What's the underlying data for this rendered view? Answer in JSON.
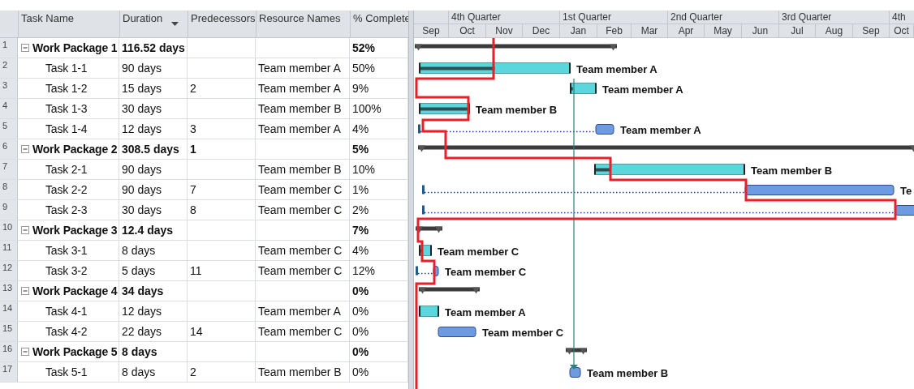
{
  "table": {
    "columns": [
      {
        "label": "Task Name"
      },
      {
        "label": "Duration",
        "filter_arrow": true
      },
      {
        "label": "Predecessors"
      },
      {
        "label": "Resource Names"
      },
      {
        "label": "% Complete"
      }
    ],
    "packages": [
      {
        "number": "1",
        "name": "Work Package 1",
        "duration": "116.52 days",
        "complete": "52%",
        "expanded": true,
        "bar": {
          "kind": "summary"
        },
        "children": [
          {
            "number": "2",
            "name": "Task 1-1",
            "duration": "90 days",
            "resource": "Team member A",
            "complete": "50%",
            "bar": {
              "kind": "active",
              "level": 0.5,
              "label": "Team member A"
            }
          },
          {
            "number": "3",
            "name": "Task 1-2",
            "duration": "15 days",
            "predecessors": "2",
            "resource": "Team member A",
            "complete": "9%",
            "bar": {
              "kind": "active",
              "level": 0.09,
              "label": "Team member A"
            }
          },
          {
            "number": "4",
            "name": "Task 1-3",
            "duration": "30 days",
            "resource": "Team member B",
            "complete": "100%",
            "bar": {
              "kind": "active",
              "level": 1,
              "label": "Team member B"
            }
          },
          {
            "number": "5",
            "name": "Task 1-4",
            "duration": "12 days",
            "predecessors": "3",
            "resource": "Team member A",
            "complete": "4%",
            "bar": {
              "kind": "split",
              "label": "Team member A"
            }
          }
        ]
      },
      {
        "number": "6",
        "name": "Work Package 2",
        "duration": "308.5 days",
        "predecessors": "1",
        "complete": "5%",
        "expanded": true,
        "bar": {
          "kind": "summary"
        },
        "children": [
          {
            "number": "7",
            "name": "Task 2-1",
            "duration": "90 days",
            "resource": "Team member B",
            "complete": "10%",
            "bar": {
              "kind": "active",
              "level": 0.1,
              "label": "Team member B"
            }
          },
          {
            "number": "8",
            "name": "Task 2-2",
            "duration": "90 days",
            "predecessors": "7",
            "resource": "Team member C",
            "complete": "1%",
            "bar": {
              "kind": "split",
              "label": "Te"
            }
          },
          {
            "number": "9",
            "name": "Task 2-3",
            "duration": "30 days",
            "predecessors": "8",
            "resource": "Team member C",
            "complete": "2%",
            "bar": {
              "kind": "split"
            }
          }
        ]
      },
      {
        "number": "10",
        "name": "Work Package 3",
        "duration": "12.4 days",
        "complete": "7%",
        "expanded": true,
        "bar": {
          "kind": "summary"
        },
        "children": [
          {
            "number": "11",
            "name": "Task 3-1",
            "duration": "8 days",
            "resource": "Team member C",
            "complete": "4%",
            "bar": {
              "kind": "active",
              "level": 0.2,
              "label": "Team member C"
            }
          },
          {
            "number": "12",
            "name": "Task 3-2",
            "duration": "5 days",
            "predecessors": "11",
            "resource": "Team member C",
            "complete": "12%",
            "bar": {
              "kind": "split",
              "label": "Team member C"
            }
          }
        ]
      },
      {
        "number": "13",
        "name": "Work Package 4",
        "duration": "34 days",
        "complete": "0%",
        "expanded": true,
        "bar": {
          "kind": "summary"
        },
        "children": [
          {
            "number": "14",
            "name": "Task 4-1",
            "duration": "12 days",
            "resource": "Team member A",
            "complete": "0%",
            "bar": {
              "kind": "active",
              "label": "Team member A"
            }
          },
          {
            "number": "15",
            "name": "Task 4-2",
            "duration": "22 days",
            "predecessors": "14",
            "resource": "Team member C",
            "complete": "0%",
            "bar": {
              "kind": "planned",
              "label": "Team member C"
            }
          }
        ]
      },
      {
        "number": "16",
        "name": "Work Package 5",
        "duration": "8 days",
        "complete": "0%",
        "expanded": true,
        "bar": {
          "kind": "summary"
        },
        "children": [
          {
            "number": "17",
            "name": "Task 5-1",
            "duration": "8 days",
            "predecessors": "2",
            "resource": "Team member B",
            "complete": "0%",
            "bar": {
              "kind": "planned",
              "label": "Team member B"
            }
          }
        ]
      }
    ]
  },
  "timescale": {
    "quarters": [
      "4th Quarter",
      "1st Quarter",
      "2nd Quarter",
      "3rd Quarter",
      "4th"
    ],
    "months": [
      "Sep",
      "Oct",
      "Nov",
      "Dec",
      "Jan",
      "Feb",
      "Mar",
      "Apr",
      "May",
      "Jun",
      "Jul",
      "Aug",
      "Sep",
      "Oct"
    ]
  }
}
